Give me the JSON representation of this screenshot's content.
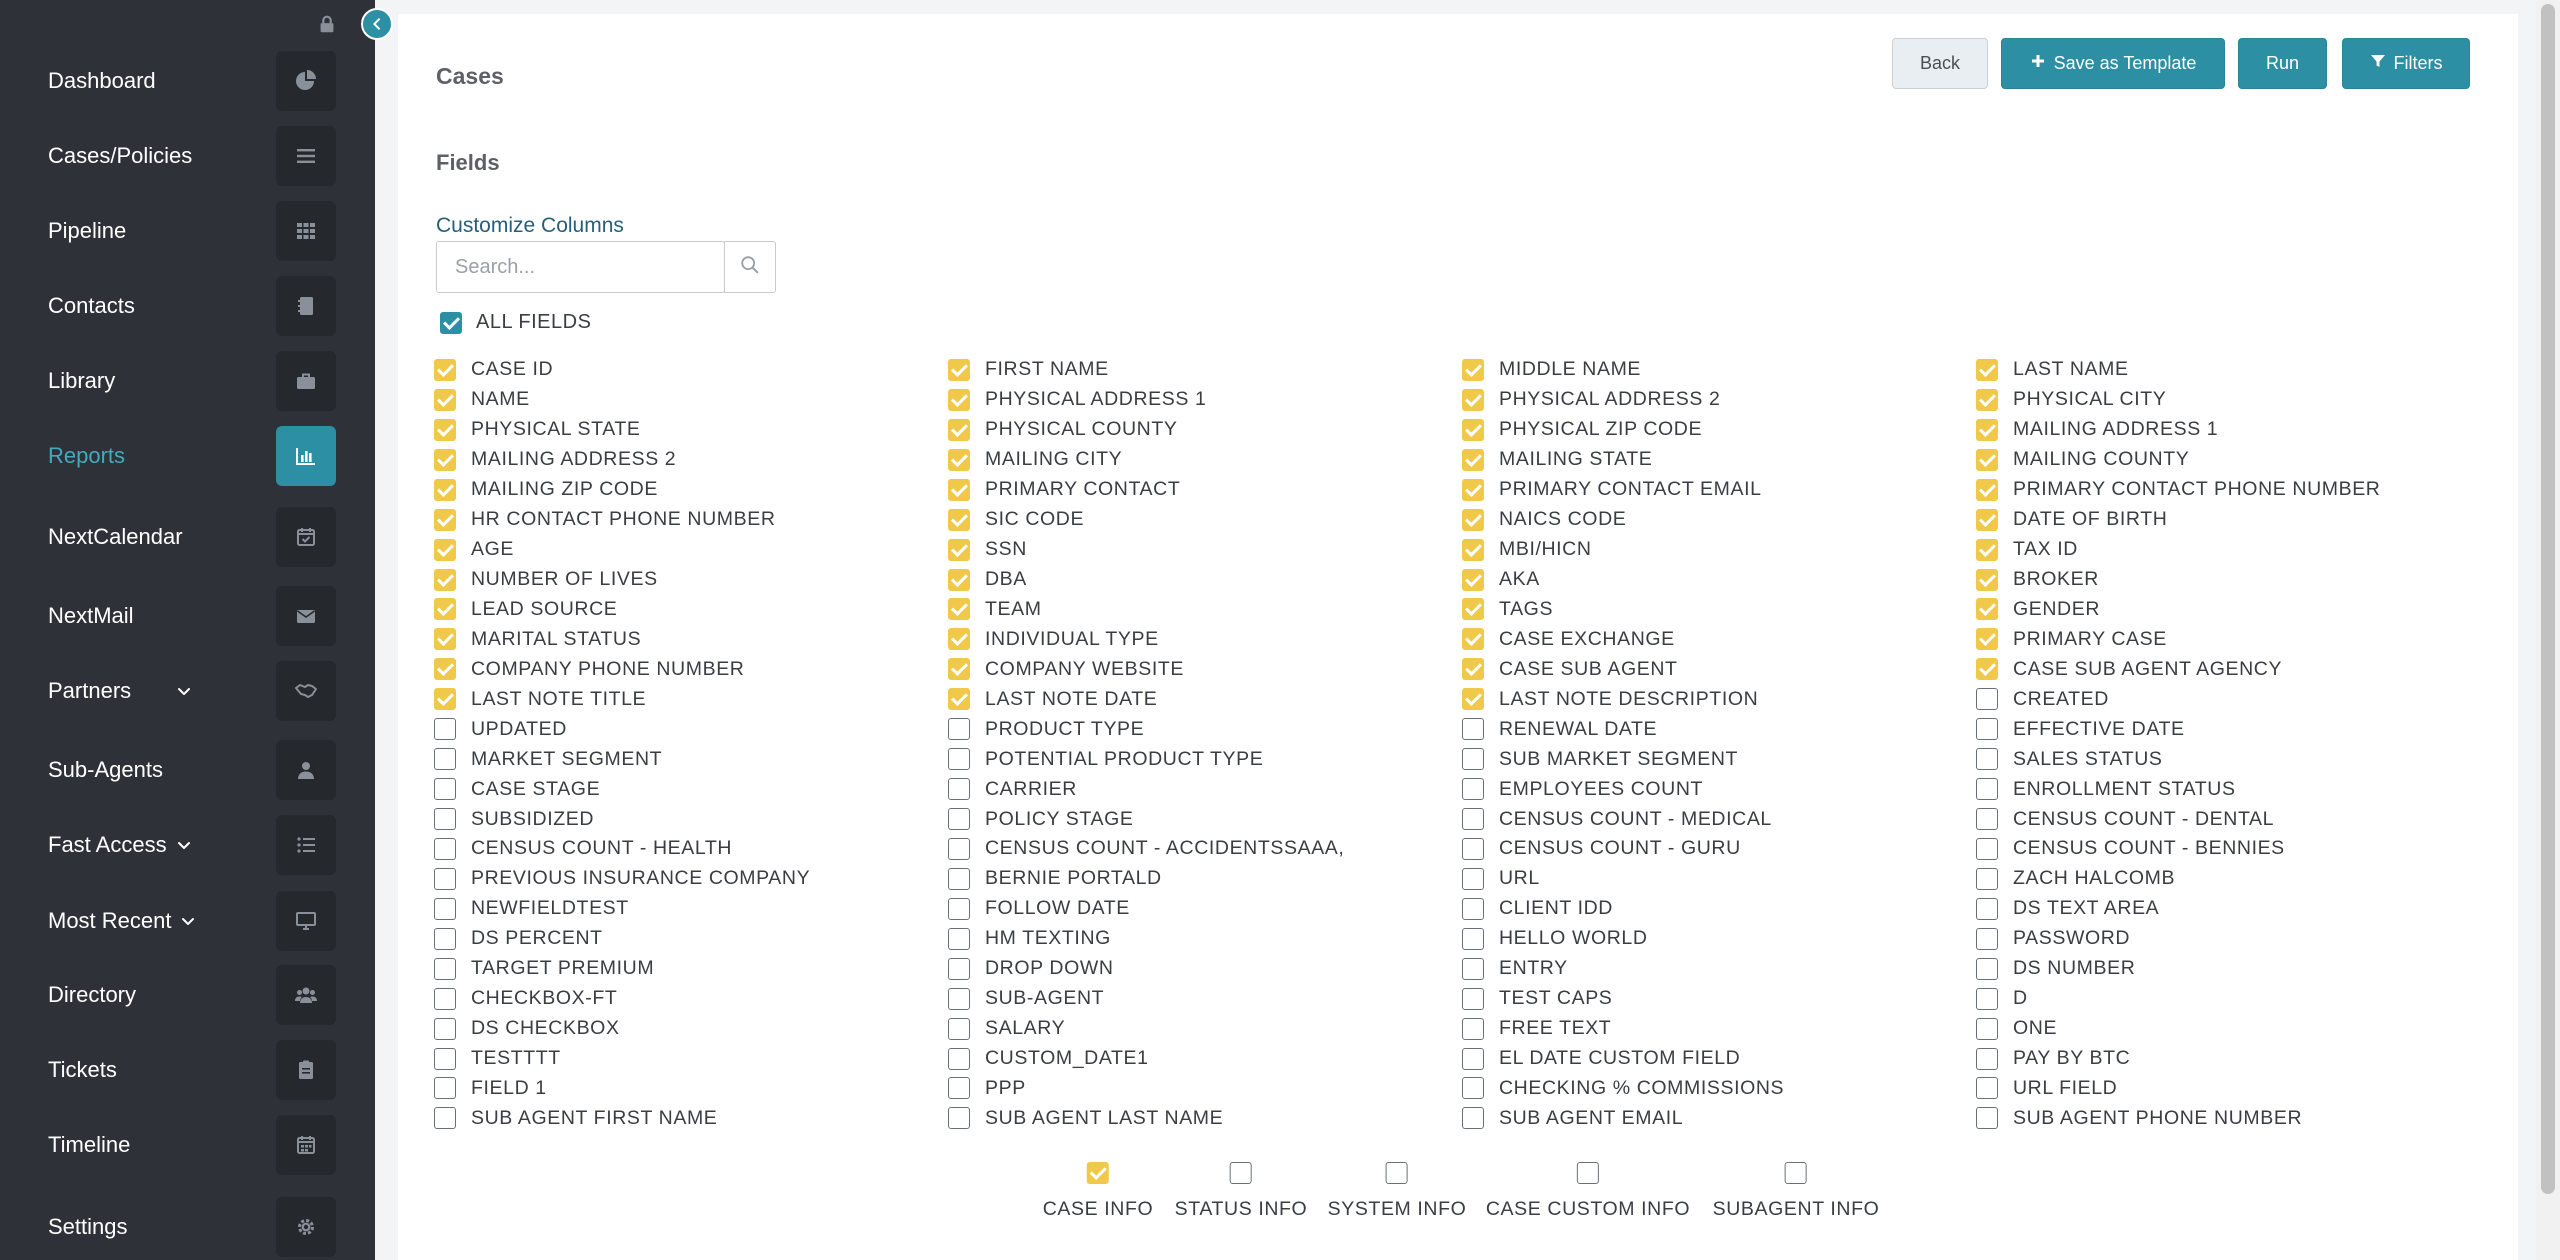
{
  "sidebar": {
    "items": [
      {
        "label": "Dashboard",
        "icon": "pie-chart-icon",
        "active": false
      },
      {
        "label": "Cases/Policies",
        "icon": "list-icon",
        "active": false
      },
      {
        "label": "Pipeline",
        "icon": "grid-icon",
        "active": false
      },
      {
        "label": "Contacts",
        "icon": "address-book-icon",
        "active": false
      },
      {
        "label": "Library",
        "icon": "briefcase-icon",
        "active": false
      },
      {
        "label": "Reports",
        "icon": "bar-chart-icon",
        "active": true
      },
      {
        "label": "NextCalendar",
        "icon": "calendar-check-icon",
        "active": false
      },
      {
        "label": "NextMail",
        "icon": "envelope-icon",
        "active": false
      },
      {
        "label": "Partners",
        "icon": "handshake-icon",
        "active": false,
        "caret": true
      },
      {
        "label": "Sub-Agents",
        "icon": "user-icon",
        "active": false
      },
      {
        "label": "Fast Access",
        "icon": "list-ul-icon",
        "active": false,
        "caret": true
      },
      {
        "label": "Most Recent",
        "icon": "desktop-icon",
        "active": false,
        "caret": true
      },
      {
        "label": "Directory",
        "icon": "users-icon",
        "active": false
      },
      {
        "label": "Tickets",
        "icon": "clipboard-icon",
        "active": false
      },
      {
        "label": "Timeline",
        "icon": "calendar-icon",
        "active": false
      },
      {
        "label": "Settings",
        "icon": "gear-icon",
        "active": false
      }
    ]
  },
  "header": {
    "title": "Cases",
    "buttons": {
      "back": "Back",
      "save_template": "Save as Template",
      "run": "Run",
      "filters": "Filters"
    }
  },
  "fields_section": {
    "heading": "Fields",
    "customize_link": "Customize Columns",
    "search_placeholder": "Search...",
    "all_fields_label": "ALL FIELDS",
    "all_fields_checked": true
  },
  "fields": [
    {
      "label": "CASE ID",
      "checked": true
    },
    {
      "label": "FIRST NAME",
      "checked": true
    },
    {
      "label": "MIDDLE NAME",
      "checked": true
    },
    {
      "label": "LAST NAME",
      "checked": true
    },
    {
      "label": "NAME",
      "checked": true
    },
    {
      "label": "PHYSICAL ADDRESS 1",
      "checked": true
    },
    {
      "label": "PHYSICAL ADDRESS 2",
      "checked": true
    },
    {
      "label": "PHYSICAL CITY",
      "checked": true
    },
    {
      "label": "PHYSICAL STATE",
      "checked": true
    },
    {
      "label": "PHYSICAL COUNTY",
      "checked": true
    },
    {
      "label": "PHYSICAL ZIP CODE",
      "checked": true
    },
    {
      "label": "MAILING ADDRESS 1",
      "checked": true
    },
    {
      "label": "MAILING ADDRESS 2",
      "checked": true
    },
    {
      "label": "MAILING CITY",
      "checked": true
    },
    {
      "label": "MAILING STATE",
      "checked": true
    },
    {
      "label": "MAILING COUNTY",
      "checked": true
    },
    {
      "label": "MAILING ZIP CODE",
      "checked": true
    },
    {
      "label": "PRIMARY CONTACT",
      "checked": true
    },
    {
      "label": "PRIMARY CONTACT EMAIL",
      "checked": true
    },
    {
      "label": "PRIMARY CONTACT PHONE NUMBER",
      "checked": true
    },
    {
      "label": "HR CONTACT PHONE NUMBER",
      "checked": true
    },
    {
      "label": "SIC CODE",
      "checked": true
    },
    {
      "label": "NAICS CODE",
      "checked": true
    },
    {
      "label": "DATE OF BIRTH",
      "checked": true
    },
    {
      "label": "AGE",
      "checked": true
    },
    {
      "label": "SSN",
      "checked": true
    },
    {
      "label": "MBI/HICN",
      "checked": true
    },
    {
      "label": "TAX ID",
      "checked": true
    },
    {
      "label": "NUMBER OF LIVES",
      "checked": true
    },
    {
      "label": "DBA",
      "checked": true
    },
    {
      "label": "AKA",
      "checked": true
    },
    {
      "label": "BROKER",
      "checked": true
    },
    {
      "label": "LEAD SOURCE",
      "checked": true
    },
    {
      "label": "TEAM",
      "checked": true
    },
    {
      "label": "TAGS",
      "checked": true
    },
    {
      "label": "GENDER",
      "checked": true
    },
    {
      "label": "MARITAL STATUS",
      "checked": true
    },
    {
      "label": "INDIVIDUAL TYPE",
      "checked": true
    },
    {
      "label": "CASE EXCHANGE",
      "checked": true
    },
    {
      "label": "PRIMARY CASE",
      "checked": true
    },
    {
      "label": "COMPANY PHONE NUMBER",
      "checked": true
    },
    {
      "label": "COMPANY WEBSITE",
      "checked": true
    },
    {
      "label": "CASE SUB AGENT",
      "checked": true
    },
    {
      "label": "CASE SUB AGENT AGENCY",
      "checked": true
    },
    {
      "label": "LAST NOTE TITLE",
      "checked": true
    },
    {
      "label": "LAST NOTE DATE",
      "checked": true
    },
    {
      "label": "LAST NOTE DESCRIPTION",
      "checked": true
    },
    {
      "label": "CREATED",
      "checked": false
    },
    {
      "label": "UPDATED",
      "checked": false
    },
    {
      "label": "PRODUCT TYPE",
      "checked": false
    },
    {
      "label": "RENEWAL DATE",
      "checked": false
    },
    {
      "label": "EFFECTIVE DATE",
      "checked": false
    },
    {
      "label": "MARKET SEGMENT",
      "checked": false
    },
    {
      "label": "POTENTIAL PRODUCT TYPE",
      "checked": false
    },
    {
      "label": "SUB MARKET SEGMENT",
      "checked": false
    },
    {
      "label": "SALES STATUS",
      "checked": false
    },
    {
      "label": "CASE STAGE",
      "checked": false
    },
    {
      "label": "CARRIER",
      "checked": false
    },
    {
      "label": "EMPLOYEES COUNT",
      "checked": false
    },
    {
      "label": "ENROLLMENT STATUS",
      "checked": false
    },
    {
      "label": "SUBSIDIZED",
      "checked": false
    },
    {
      "label": "POLICY STAGE",
      "checked": false
    },
    {
      "label": "CENSUS COUNT - MEDICAL",
      "checked": false
    },
    {
      "label": "CENSUS COUNT - DENTAL",
      "checked": false
    },
    {
      "label": "CENSUS COUNT - HEALTH",
      "checked": false
    },
    {
      "label": "CENSUS COUNT - ACCIDENTSSAAA,",
      "checked": false
    },
    {
      "label": "CENSUS COUNT - GURU",
      "checked": false
    },
    {
      "label": "CENSUS COUNT - BENNIES",
      "checked": false
    },
    {
      "label": "PREVIOUS INSURANCE COMPANY",
      "checked": false
    },
    {
      "label": "BERNIE PORTALD",
      "checked": false
    },
    {
      "label": "URL",
      "checked": false
    },
    {
      "label": "ZACH HALCOMB",
      "checked": false
    },
    {
      "label": "NEWFIELDTEST",
      "checked": false
    },
    {
      "label": "FOLLOW DATE",
      "checked": false
    },
    {
      "label": "CLIENT IDD",
      "checked": false
    },
    {
      "label": "DS TEXT AREA",
      "checked": false
    },
    {
      "label": "DS PERCENT",
      "checked": false
    },
    {
      "label": "HM TEXTING",
      "checked": false
    },
    {
      "label": "HELLO WORLD",
      "checked": false
    },
    {
      "label": "PASSWORD",
      "checked": false
    },
    {
      "label": "TARGET PREMIUM",
      "checked": false
    },
    {
      "label": "DROP DOWN",
      "checked": false
    },
    {
      "label": "ENTRY",
      "checked": false
    },
    {
      "label": "DS NUMBER",
      "checked": false
    },
    {
      "label": "CHECKBOX-FT",
      "checked": false
    },
    {
      "label": "SUB-AGENT",
      "checked": false
    },
    {
      "label": "TEST CAPS",
      "checked": false
    },
    {
      "label": "D",
      "checked": false
    },
    {
      "label": "DS CHECKBOX",
      "checked": false
    },
    {
      "label": "SALARY",
      "checked": false
    },
    {
      "label": "FREE TEXT",
      "checked": false
    },
    {
      "label": "ONE",
      "checked": false
    },
    {
      "label": "TESTTTT",
      "checked": false
    },
    {
      "label": "CUSTOM_DATE1",
      "checked": false
    },
    {
      "label": "EL DATE CUSTOM FIELD",
      "checked": false
    },
    {
      "label": "PAY BY BTC",
      "checked": false
    },
    {
      "label": "FIELD 1",
      "checked": false
    },
    {
      "label": "PPP",
      "checked": false
    },
    {
      "label": "CHECKING % COMMISSIONS",
      "checked": false
    },
    {
      "label": "URL FIELD",
      "checked": false
    },
    {
      "label": "SUB AGENT FIRST NAME",
      "checked": false
    },
    {
      "label": "SUB AGENT LAST NAME",
      "checked": false
    },
    {
      "label": "SUB AGENT EMAIL",
      "checked": false
    },
    {
      "label": "SUB AGENT PHONE NUMBER",
      "checked": false
    }
  ],
  "categories": [
    {
      "label": "CASE INFO",
      "checked": true
    },
    {
      "label": "STATUS INFO",
      "checked": false
    },
    {
      "label": "SYSTEM INFO",
      "checked": false
    },
    {
      "label": "CASE CUSTOM INFO",
      "checked": false
    },
    {
      "label": "SUBAGENT INFO",
      "checked": false
    }
  ],
  "colors": {
    "sidebar_bg": "#2e3238",
    "accent": "#2c8fa3",
    "active_text": "#44a9bf",
    "checkbox_checked": "#f0c94b",
    "link": "#275f7a"
  }
}
